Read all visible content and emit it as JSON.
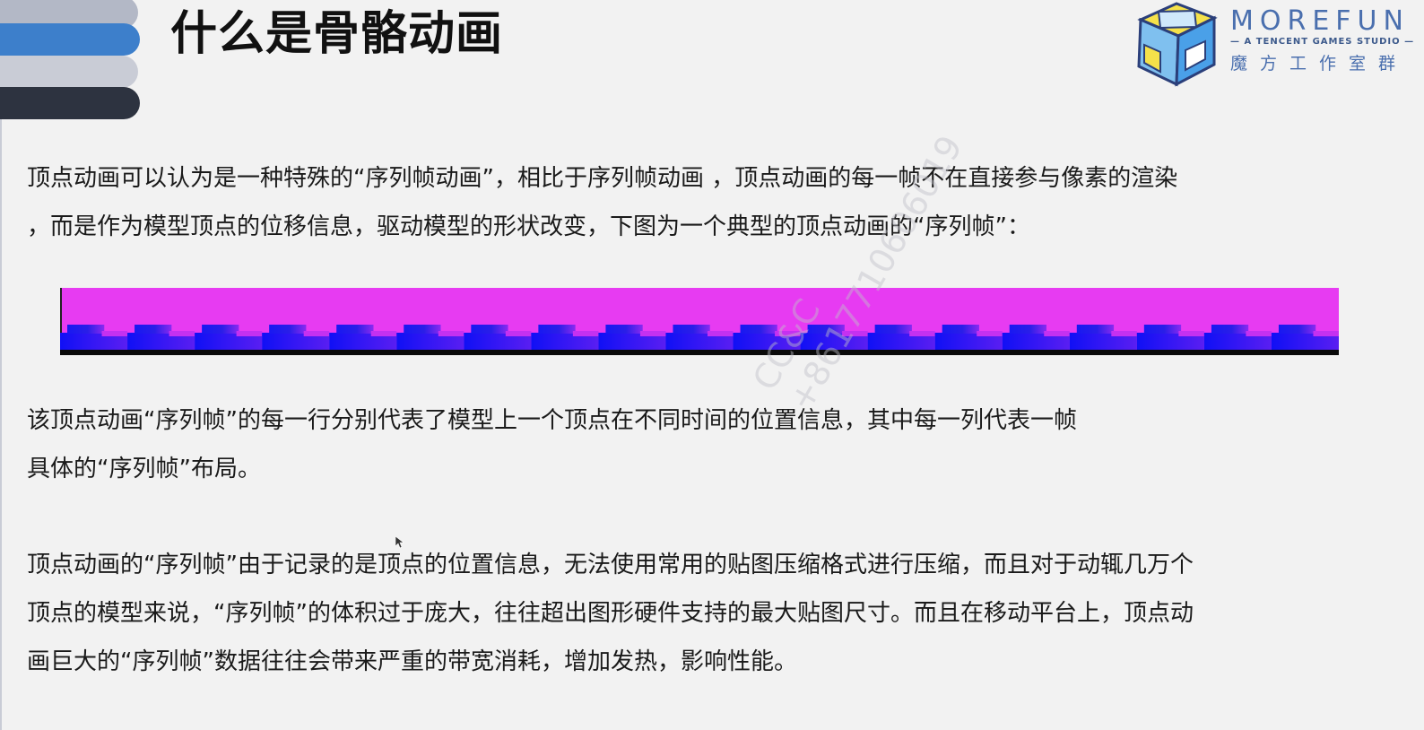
{
  "slide": {
    "title": "什么是骨骼动画",
    "colors": {
      "background": "#f2f2f2",
      "deco_bars": [
        "#b3b8c6",
        "#3d7fcb",
        "#c9ccd6",
        "#2d3340"
      ],
      "frame_magenta": "#e73bf2",
      "frame_blue": "#1a1af0"
    }
  },
  "logo": {
    "name": "MOREFUN",
    "subtitle": "— A TENCENT GAMES STUDIO —",
    "chinese": "魔方工作室群",
    "icon": "cube-logo-icon"
  },
  "paragraphs": [
    {
      "lines": [
        "顶点动画可以认为是一种特殊的“序列帧动画”，相比于序列帧动画 ，顶点动画的每一帧不在直接参与像素的渲染",
        "，而是作为模型顶点的位移信息，驱动模型的形状改变，下图为一个典型的顶点动画的“序列帧”："
      ]
    },
    {
      "lines": [
        "该顶点动画“序列帧”的每一行分别代表了模型上一个顶点在不同时间的位置信息，其中每一列代表一帧",
        "具体的“序列帧”布局。"
      ]
    },
    {
      "lines": [
        "顶点动画的“序列帧”由于记录的是顶点的位置信息，无法使用常用的贴图压缩格式进行压缩，而且对于动辄几万个",
        "顶点的模型来说，“序列帧”的体积过于庞大，往往超出图形硬件支持的最大贴图尺寸。而且在移动平台上，顶点动",
        "画巨大的“序列帧”数据往往会带来严重的带宽消耗，增加发热，影响性能。"
      ]
    }
  ],
  "frame_strip": {
    "segments": 19
  },
  "watermark": {
    "lines": [
      "CC&C",
      "+8617710606019"
    ]
  }
}
